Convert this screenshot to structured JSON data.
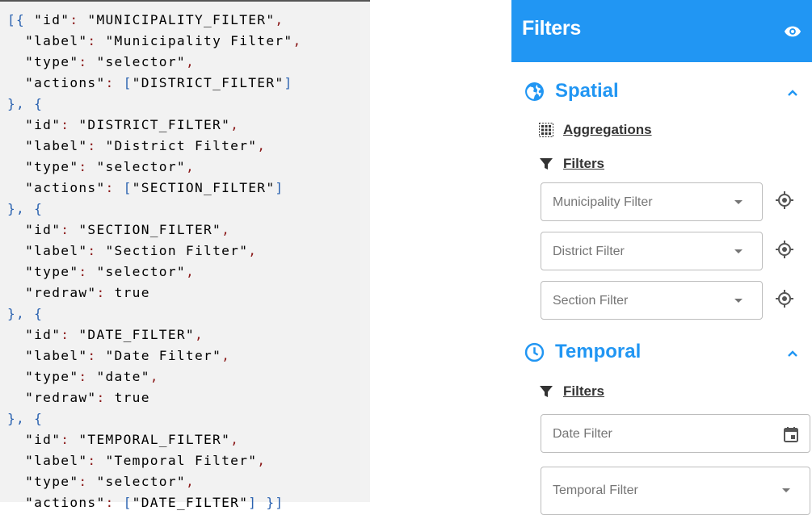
{
  "code": {
    "lines": [
      [
        [
          "punc",
          "[{ "
        ],
        [
          "str",
          "\"id\""
        ],
        [
          "colon",
          ": "
        ],
        [
          "str",
          "\"MUNICIPALITY_FILTER\""
        ],
        [
          "colon",
          ","
        ]
      ],
      [
        [
          "key",
          "  \"label\""
        ],
        [
          "colon",
          ": "
        ],
        [
          "str",
          "\"Municipality Filter\""
        ],
        [
          "colon",
          ","
        ]
      ],
      [
        [
          "key",
          "  \"type\""
        ],
        [
          "colon",
          ": "
        ],
        [
          "str",
          "\"selector\""
        ],
        [
          "colon",
          ","
        ]
      ],
      [
        [
          "key",
          "  \"actions\""
        ],
        [
          "colon",
          ": "
        ],
        [
          "punc",
          "["
        ],
        [
          "str",
          "\"DISTRICT_FILTER\""
        ],
        [
          "punc",
          "]"
        ]
      ],
      [
        [
          "punc",
          "}, {"
        ]
      ],
      [
        [
          "key",
          "  \"id\""
        ],
        [
          "colon",
          ": "
        ],
        [
          "str",
          "\"DISTRICT_FILTER\""
        ],
        [
          "colon",
          ","
        ]
      ],
      [
        [
          "key",
          "  \"label\""
        ],
        [
          "colon",
          ": "
        ],
        [
          "str",
          "\"District Filter\""
        ],
        [
          "colon",
          ","
        ]
      ],
      [
        [
          "key",
          "  \"type\""
        ],
        [
          "colon",
          ": "
        ],
        [
          "str",
          "\"selector\""
        ],
        [
          "colon",
          ","
        ]
      ],
      [
        [
          "key",
          "  \"actions\""
        ],
        [
          "colon",
          ": "
        ],
        [
          "punc",
          "["
        ],
        [
          "str",
          "\"SECTION_FILTER\""
        ],
        [
          "punc",
          "]"
        ]
      ],
      [
        [
          "punc",
          "}, {"
        ]
      ],
      [
        [
          "key",
          "  \"id\""
        ],
        [
          "colon",
          ": "
        ],
        [
          "str",
          "\"SECTION_FILTER\""
        ],
        [
          "colon",
          ","
        ]
      ],
      [
        [
          "key",
          "  \"label\""
        ],
        [
          "colon",
          ": "
        ],
        [
          "str",
          "\"Section Filter\""
        ],
        [
          "colon",
          ","
        ]
      ],
      [
        [
          "key",
          "  \"type\""
        ],
        [
          "colon",
          ": "
        ],
        [
          "str",
          "\"selector\""
        ],
        [
          "colon",
          ","
        ]
      ],
      [
        [
          "key",
          "  \"redraw\""
        ],
        [
          "colon",
          ": "
        ],
        [
          "bool",
          "true"
        ]
      ],
      [
        [
          "punc",
          "}, {"
        ]
      ],
      [
        [
          "key",
          "  \"id\""
        ],
        [
          "colon",
          ": "
        ],
        [
          "str",
          "\"DATE_FILTER\""
        ],
        [
          "colon",
          ","
        ]
      ],
      [
        [
          "key",
          "  \"label\""
        ],
        [
          "colon",
          ": "
        ],
        [
          "str",
          "\"Date Filter\""
        ],
        [
          "colon",
          ","
        ]
      ],
      [
        [
          "key",
          "  \"type\""
        ],
        [
          "colon",
          ": "
        ],
        [
          "str",
          "\"date\""
        ],
        [
          "colon",
          ","
        ]
      ],
      [
        [
          "key",
          "  \"redraw\""
        ],
        [
          "colon",
          ": "
        ],
        [
          "bool",
          "true"
        ]
      ],
      [
        [
          "punc",
          "}, {"
        ]
      ],
      [
        [
          "key",
          "  \"id\""
        ],
        [
          "colon",
          ": "
        ],
        [
          "str",
          "\"TEMPORAL_FILTER\""
        ],
        [
          "colon",
          ","
        ]
      ],
      [
        [
          "key",
          "  \"label\""
        ],
        [
          "colon",
          ": "
        ],
        [
          "str",
          "\"Temporal Filter\""
        ],
        [
          "colon",
          ","
        ]
      ],
      [
        [
          "key",
          "  \"type\""
        ],
        [
          "colon",
          ": "
        ],
        [
          "str",
          "\"selector\""
        ],
        [
          "colon",
          ","
        ]
      ],
      [
        [
          "key",
          "  \"actions\""
        ],
        [
          "colon",
          ": "
        ],
        [
          "punc",
          "["
        ],
        [
          "str",
          "\"DATE_FILTER\""
        ],
        [
          "punc",
          "] }]"
        ]
      ]
    ]
  },
  "panel": {
    "title": "Filters",
    "header_color": "#2196f3",
    "header_icon": "eye-icon",
    "spatial": {
      "title": "Spatial",
      "icon": "globe-icon",
      "aggregations_label": "Aggregations",
      "filters_label": "Filters",
      "selects": [
        {
          "placeholder": "Municipality Filter",
          "icon": "target-icon"
        },
        {
          "placeholder": "District Filter",
          "icon": "target-icon"
        },
        {
          "placeholder": "Section Filter",
          "icon": "target-icon"
        }
      ]
    },
    "temporal": {
      "title": "Temporal",
      "icon": "clock-icon",
      "filters_label": "Filters",
      "date_placeholder": "Date Filter",
      "select_placeholder": "Temporal Filter"
    }
  }
}
